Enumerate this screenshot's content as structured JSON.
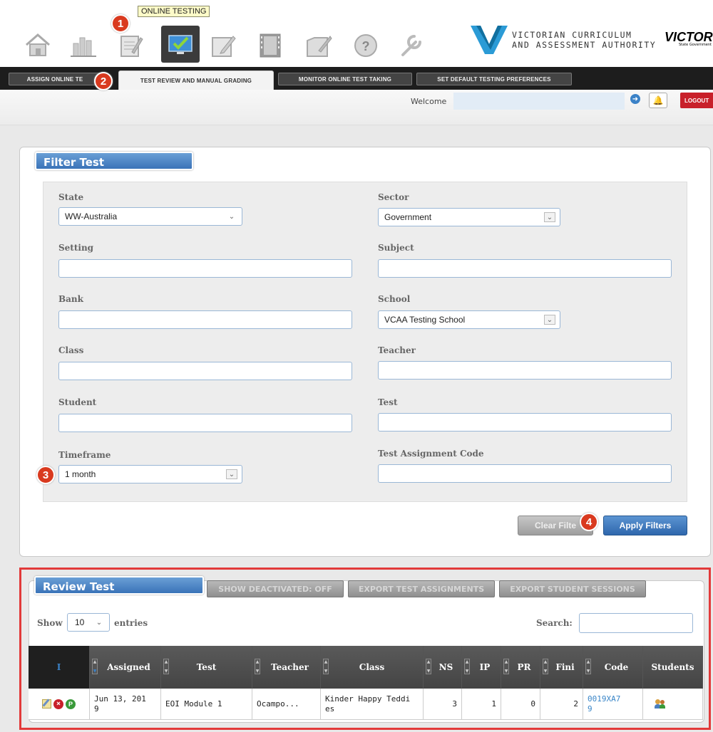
{
  "nav": {
    "tooltip": "ONLINE TESTING",
    "icons": [
      "home-icon",
      "reports-icon",
      "authoring-icon",
      "online-testing-icon",
      "grading-icon",
      "film-icon",
      "tools-icon",
      "help-icon",
      "wrench-icon"
    ]
  },
  "branding": {
    "vcaa_line1": "VICTORIAN CURRICULUM",
    "vcaa_line2": "AND ASSESSMENT AUTHORITY",
    "victoria": "VICTORIA",
    "victoria_sub": "State Government"
  },
  "tabs": [
    {
      "label": "ASSIGN ONLINE TE"
    },
    {
      "label": "TEST REVIEW AND MANUAL GRADING"
    },
    {
      "label": "MONITOR ONLINE TEST TAKING"
    },
    {
      "label": "SET DEFAULT TESTING PREFERENCES"
    }
  ],
  "header": {
    "welcome": "Welcome",
    "logout": "LOGOUT"
  },
  "badges": [
    "1",
    "2",
    "3",
    "4"
  ],
  "filter": {
    "title": "Filter Test Assignments",
    "state_label": "State",
    "state_value": "WW-Australia",
    "sector_label": "Sector",
    "sector_value": "Government",
    "setting_label": "Setting",
    "subject_label": "Subject",
    "bank_label": "Bank",
    "school_label": "School",
    "school_value": "VCAA Testing School",
    "class_label": "Class",
    "teacher_label": "Teacher",
    "student_label": "Student",
    "test_label": "Test",
    "timeframe_label": "Timeframe",
    "timeframe_value": "1 month",
    "code_label": "Test Assignment Code",
    "clear_button": "Clear Filte",
    "apply_button": "Apply Filters"
  },
  "review": {
    "title": "Review Test Assignments",
    "show_deactivated": "SHOW DEACTIVATED: OFF",
    "export_assignments": "EXPORT TEST ASSIGNMENTS",
    "export_sessions": "EXPORT STUDENT SESSIONS",
    "show_label": "Show",
    "entries_value": "10",
    "entries_label": "entries",
    "search_label": "Search:",
    "columns": {
      "marker": "I",
      "assigned": "Assigned",
      "test": "Test",
      "teacher": "Teacher",
      "class": "Class",
      "ns": "NS",
      "ip": "IP",
      "pr": "PR",
      "fini": "Fini",
      "code": "Code",
      "students": "Students"
    },
    "row": {
      "assigned_l1": "Jun 13, 201",
      "assigned_l2": "9",
      "test": "EOI Module 1",
      "teacher": "Ocampo...",
      "class_l1": "Kinder Happy Teddi",
      "class_l2": "es",
      "ns": "3",
      "ip": "1",
      "pr": "0",
      "fini": "2",
      "code_l1": "0019XA7",
      "code_l2": "9"
    }
  },
  "colors": {
    "accent": "#3a73b8",
    "highlight": "#e23a3a",
    "logout": "#c8202a",
    "code_link": "#3a86c8"
  }
}
